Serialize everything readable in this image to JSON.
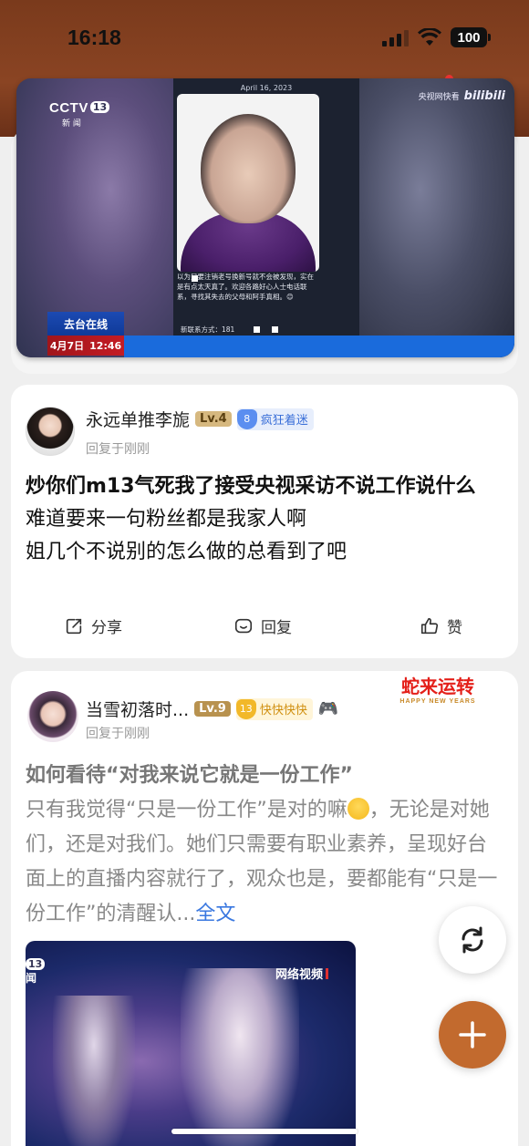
{
  "status_bar": {
    "time": "16:18",
    "battery": "100"
  },
  "top_video": {
    "channel": "CCTV",
    "channel_num": "13",
    "channel_sub": "新 闻",
    "source_label": "央视网快看",
    "platform": "bilibili",
    "phone_date": "April 16, 2023",
    "phone_text": "以为只要注销老号换新号就不会被发现，实在是有点太天真了。欢迎各路好心人士电话联系，寻找其失去的父母和阿手真相。😊",
    "phone_contact": "新联系方式：181",
    "lower_third": "去台在线",
    "date": "4月7日",
    "time": "12:46"
  },
  "comment": {
    "username": "永远单推李旎",
    "level": "Lv.4",
    "fan_level": "8",
    "fan_title": "疯狂着迷",
    "reply_meta": "回复于刚刚",
    "lines": [
      "炒你们m13气死我了接受央视采访不说工作说什么",
      "难道要来一句粉丝都是我家人啊",
      "姐几个不说别的怎么做的总看到了吧"
    ],
    "actions": {
      "share": "分享",
      "reply": "回复",
      "like": "赞"
    }
  },
  "post": {
    "username": "当雪初落时...",
    "level": "Lv.9",
    "fan_level": "13",
    "fan_title": "快快快快",
    "reply_meta": "回复于刚刚",
    "decoration": "蛇来运转",
    "decoration_sub": "HAPPY NEW YEARS",
    "title": "如何看待“对我来说它就是一份工作”",
    "body_before_emoji": "只有我觉得“只是一份工作”是对的嘛",
    "body_after_emoji": "，无论是对她们，还是对我们。她们只需要有职业素养，呈现好台面上的直播内容就行了，观众也是，要都能有“只是一份工作”的清醒认...",
    "more": "全文",
    "video_channel_num": "13",
    "video_channel_sub": "闻",
    "video_label": "网络视频"
  },
  "colors": {
    "accent": "#c26a2e",
    "link": "#3a78e0",
    "top_band": "#8a4423"
  }
}
